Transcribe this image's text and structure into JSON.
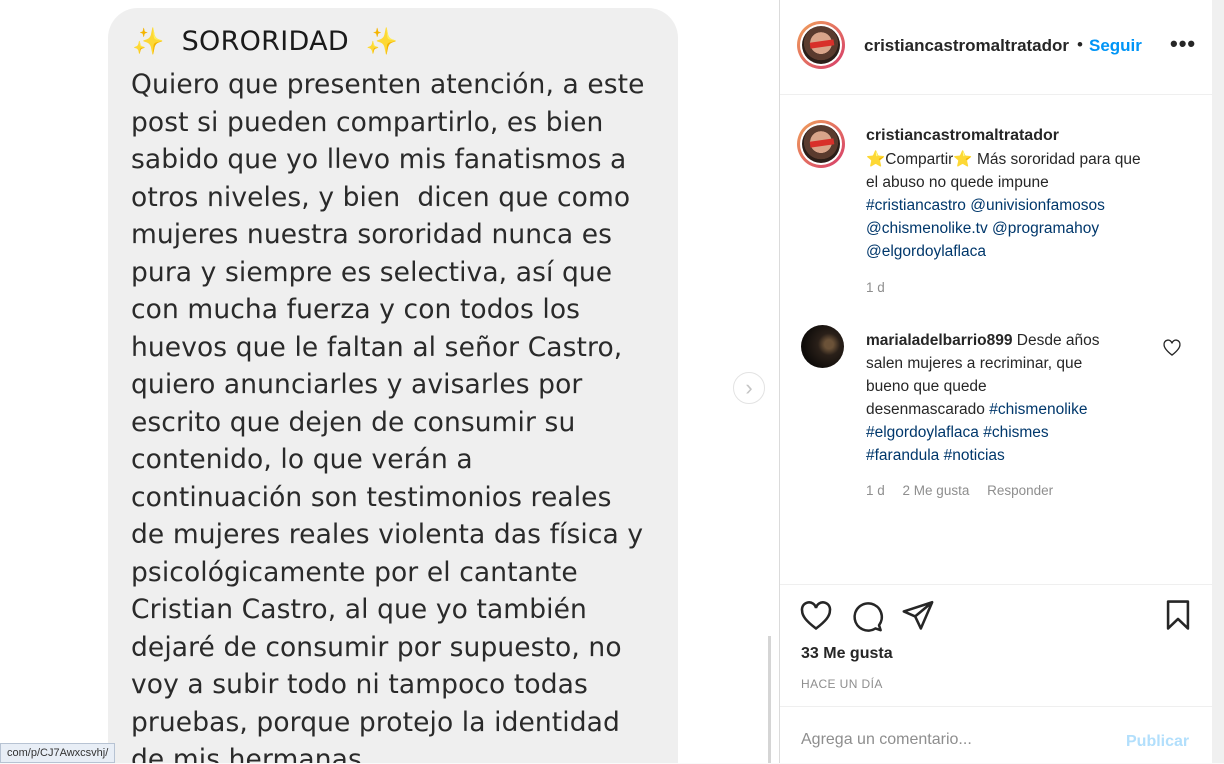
{
  "post": {
    "title": "SORORIDAD",
    "sparkle_icon": "✨",
    "body_lines": [
      "Quiero que presenten atención, a este",
      "post si pueden compartirlo, es bien",
      "sabido que yo llevo mis fanatismos a",
      "otros niveles, y bien  dicen que como",
      "mujeres nuestra sororidad nunca es",
      "pura y siempre es selectiva, así que",
      "con mucha fuerza y con todos los",
      "huevos que le faltan al señor Castro,",
      "quiero anunciarles y avisarles por",
      "escrito que dejen de consumir su",
      "contenido, lo que verán a",
      "continuación son testimonios reales",
      "de mujeres reales violenta das física y",
      "psicológicamente por el cantante",
      "Cristian Castro, al que yo también",
      "dejaré de consumir por supuesto, no",
      "voy a subir todo ni tampoco todas",
      "pruebas, porque protejo la identidad",
      "de mis hermanas."
    ],
    "next_icon": "›"
  },
  "statusbar": {
    "url": "com/p/CJ7Awxcsvhj/"
  },
  "header": {
    "username": "cristiancastromaltratador",
    "separator": "•",
    "follow_label": "Seguir",
    "more_label": "•••"
  },
  "caption": {
    "username": "cristiancastromaltratador",
    "line1": "⭐Compartir⭐ Más sororidad para que",
    "line2": "el abuso no quede impune",
    "tags1": [
      "#cristiancastro",
      "@univisionfamosos"
    ],
    "tags2": [
      "@chismenolike.tv",
      "@programahoy"
    ],
    "tags3": [
      "@elgordoylaflaca"
    ],
    "time": "1 d"
  },
  "comment": {
    "username": "marialadelbarrio899",
    "line1": "Desde años",
    "line2": "salen mujeres a recriminar, que",
    "line3": "bueno que quede",
    "line4_text": "desenmascarado",
    "line4_tag": "#chismenolike",
    "tags5": [
      "#elgordoylaflaca",
      "#chismes"
    ],
    "tags6": [
      "#farandula",
      "#noticias"
    ],
    "time": "1 d",
    "likes": "2 Me gusta",
    "reply_label": "Responder"
  },
  "actions": {
    "likes": "33 Me gusta",
    "ago": "HACE UN DÍA"
  },
  "comment_box": {
    "placeholder": "Agrega un comentario...",
    "publish_label": "Publicar"
  },
  "colors": {
    "accent_blue": "#0095f6",
    "link_blue": "#00376b",
    "publish_disabled": "#b2dffc",
    "bubble_bg": "#efefef"
  }
}
